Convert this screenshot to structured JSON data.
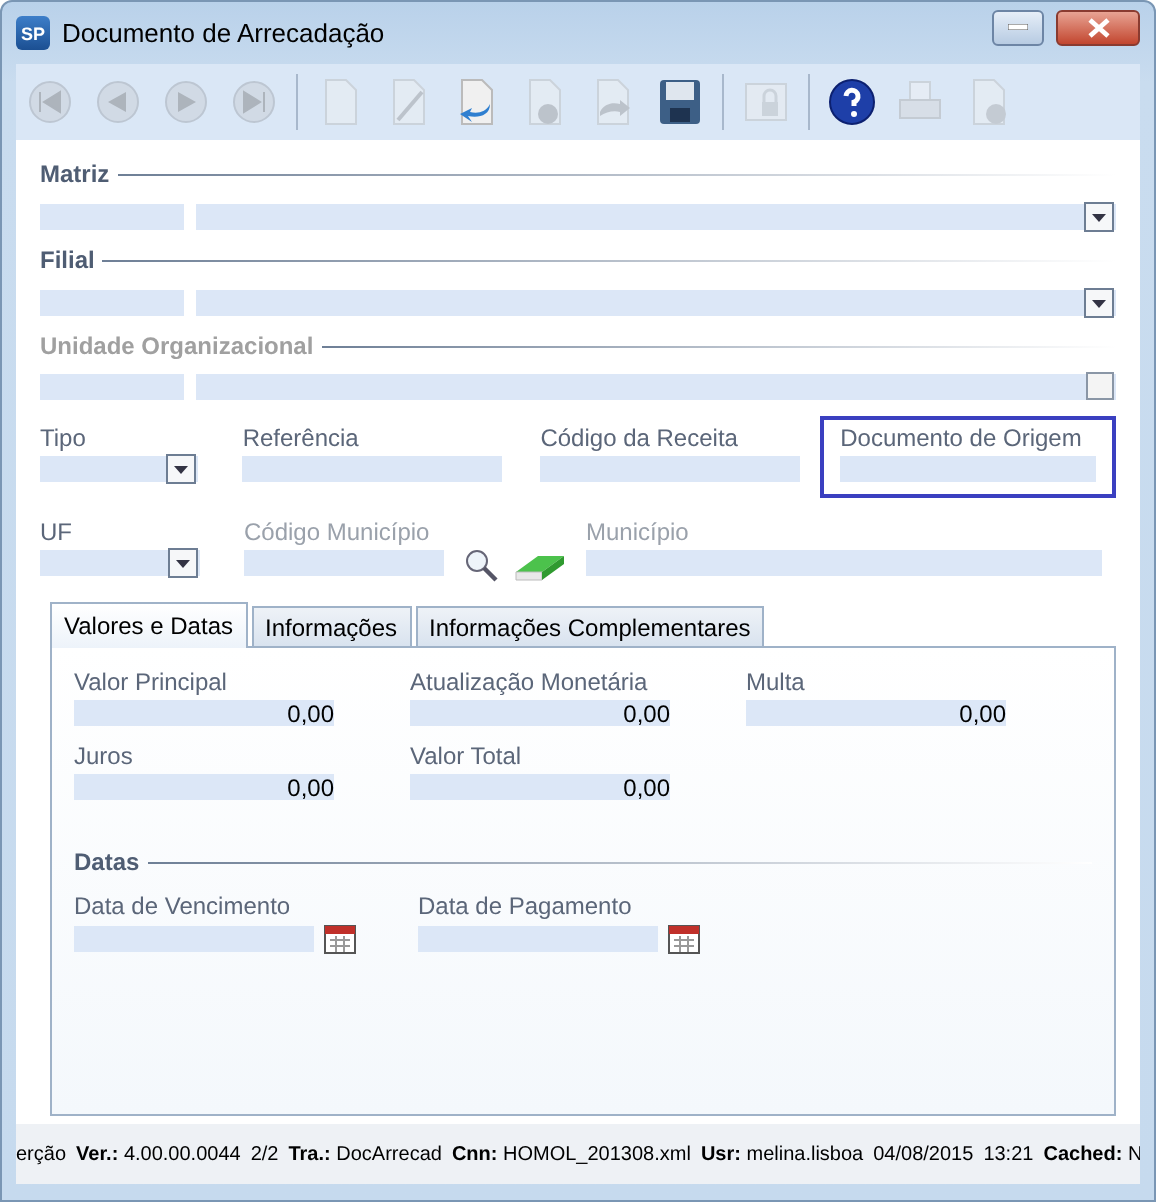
{
  "window": {
    "title": "Documento de Arrecadação",
    "logo_text": "SP"
  },
  "toolbar": [
    {
      "kind": "first",
      "disabled": true
    },
    {
      "kind": "previous",
      "disabled": true
    },
    {
      "kind": "next",
      "disabled": true
    },
    {
      "kind": "last",
      "disabled": true
    },
    {
      "kind": "separator"
    },
    {
      "kind": "new",
      "disabled": true
    },
    {
      "kind": "edit",
      "disabled": true
    },
    {
      "kind": "undo",
      "disabled": false
    },
    {
      "kind": "delete",
      "disabled": true
    },
    {
      "kind": "redo",
      "disabled": true
    },
    {
      "kind": "save",
      "disabled": false
    },
    {
      "kind": "separator"
    },
    {
      "kind": "lock",
      "disabled": true
    },
    {
      "kind": "separator"
    },
    {
      "kind": "help",
      "disabled": false
    },
    {
      "kind": "print",
      "disabled": true
    },
    {
      "kind": "sum",
      "disabled": true
    }
  ],
  "sections": [
    {
      "title": "Matriz",
      "disabled": false,
      "kind": "dropdown"
    },
    {
      "title": "Filial",
      "disabled": false,
      "kind": "dropdown"
    },
    {
      "title": "Unidade Organizacional",
      "disabled": true,
      "kind": "checkbox",
      "checked": false
    }
  ],
  "fields_row_1": [
    {
      "label": "Tipo",
      "kind": "dropdown",
      "disabled": false,
      "focused": false
    },
    {
      "label": "Referência",
      "kind": "text",
      "disabled": false,
      "focused": false
    },
    {
      "label": "Código da Receita",
      "kind": "text",
      "disabled": false,
      "focused": false
    },
    {
      "label": "Documento de Origem",
      "kind": "text",
      "disabled": false,
      "focused": true
    }
  ],
  "fields_row_2": [
    {
      "label": "UF",
      "kind": "dropdown",
      "disabled": false
    },
    {
      "label": "Código Município",
      "kind": "lookup",
      "disabled": true
    },
    {
      "label": "Município",
      "kind": "text",
      "disabled": true
    }
  ],
  "tabs": [
    {
      "label": "Valores e Datas",
      "selected": true
    },
    {
      "label": "Informações",
      "selected": false
    },
    {
      "label": "Informações Complementares",
      "selected": false
    }
  ],
  "values": [
    {
      "label": "Valor Principal",
      "value": "0,00"
    },
    {
      "label": "Atualização Monetária",
      "value": "0,00"
    },
    {
      "label": "Multa",
      "value": "0,00"
    },
    {
      "label": "Juros",
      "value": "0,00"
    },
    {
      "label": "Valor Total",
      "value": "0,00"
    }
  ],
  "dates_section": {
    "title": "Datas"
  },
  "dates": [
    {
      "label": "Data de Vencimento"
    },
    {
      "label": "Data de Pagamento"
    }
  ],
  "status_bar": [
    {
      "value": "erção"
    },
    {
      "label": "Ver.:",
      "value": "4.00.00.0044"
    },
    {
      "value": "2/2"
    },
    {
      "label": "Tra.:",
      "value": "DocArrecad"
    },
    {
      "label": "Cnn:",
      "value": "HOMOL_201308.xml"
    },
    {
      "label": "Usr:",
      "value": "melina.lisboa"
    },
    {
      "value": "04/08/2015"
    },
    {
      "value": "13:21"
    },
    {
      "label": "Cached:",
      "value": "N"
    }
  ]
}
